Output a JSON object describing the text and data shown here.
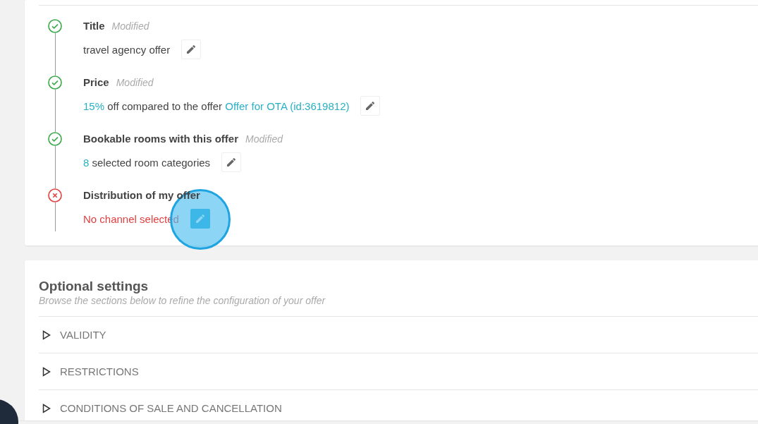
{
  "steps": [
    {
      "title": "Title",
      "badge": "Modified",
      "complete": true,
      "value": [
        {
          "kind": "text",
          "text": "travel agency offer"
        }
      ],
      "edit_pressed": false
    },
    {
      "title": "Price",
      "badge": "Modified",
      "complete": true,
      "value": [
        {
          "kind": "link",
          "text": "15%"
        },
        {
          "kind": "text",
          "text": "off compared to the offer"
        },
        {
          "kind": "link",
          "text": "Offer for OTA (id:3619812)"
        }
      ],
      "edit_pressed": false
    },
    {
      "title": "Bookable rooms with this offer",
      "badge": "Modified",
      "complete": true,
      "value": [
        {
          "kind": "link",
          "text": "8"
        },
        {
          "kind": "text",
          "text": "selected room categories"
        }
      ],
      "edit_pressed": false
    },
    {
      "title": "Distribution of my offer",
      "complete": false,
      "value": [
        {
          "kind": "error",
          "text": "No channel selected"
        }
      ],
      "edit_pressed": true
    }
  ],
  "optional_settings": {
    "title": "Optional settings",
    "subtitle": "Browse the sections below to refine the configuration of your offer",
    "sections": [
      {
        "label": "VALIDITY",
        "expanded": false
      },
      {
        "label": "RESTRICTIONS",
        "expanded": false
      },
      {
        "label": "CONDITIONS OF SALE AND CANCELLATION",
        "expanded": false
      }
    ]
  }
}
